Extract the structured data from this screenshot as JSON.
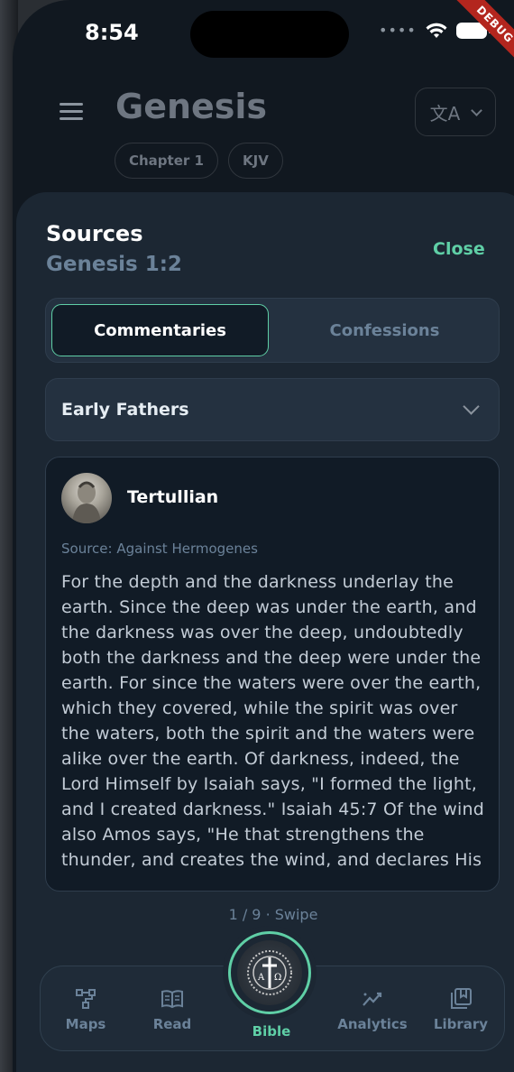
{
  "status": {
    "time": "8:54",
    "debug_label": "DEBUG"
  },
  "header": {
    "title": "Genesis",
    "chips": [
      "Chapter 1",
      "KJV"
    ]
  },
  "sheet": {
    "title": "Sources",
    "subtitle": "Genesis 1:2",
    "close_label": "Close",
    "tabs": [
      {
        "label": "Commentaries",
        "active": true
      },
      {
        "label": "Confessions",
        "active": false
      }
    ],
    "dropdown": {
      "selected": "Early Fathers"
    },
    "card": {
      "author": "Tertullian",
      "source": "Source: Against Hermogenes",
      "text": "For the depth and the darkness underlay the earth. Since the deep was under the earth, and the darkness was over the deep, undoubtedly both the darkness and the deep were under the earth. For since the waters were over the earth, which they covered, while the spirit was over the waters, both the spirit and the waters were alike over the earth. Of darkness, indeed, the Lord Himself by Isaiah says, \"I formed the light, and I created darkness.\" Isaiah 45:7 Of the wind also Amos says, \"He that strengthens the thunder, and creates the wind, and declares His"
    },
    "pager": "1 / 9 · Swipe"
  },
  "nav": {
    "items": [
      {
        "label": "Maps",
        "icon": "maps-icon"
      },
      {
        "label": "Read",
        "icon": "book-icon"
      },
      {
        "label": "Bible",
        "icon": "bible-emblem-icon",
        "active": true
      },
      {
        "label": "Analytics",
        "icon": "analytics-icon"
      },
      {
        "label": "Library",
        "icon": "library-icon"
      }
    ]
  },
  "colors": {
    "accent": "#5fcfa6",
    "background": "#111820",
    "sheet": "#1c2733"
  }
}
